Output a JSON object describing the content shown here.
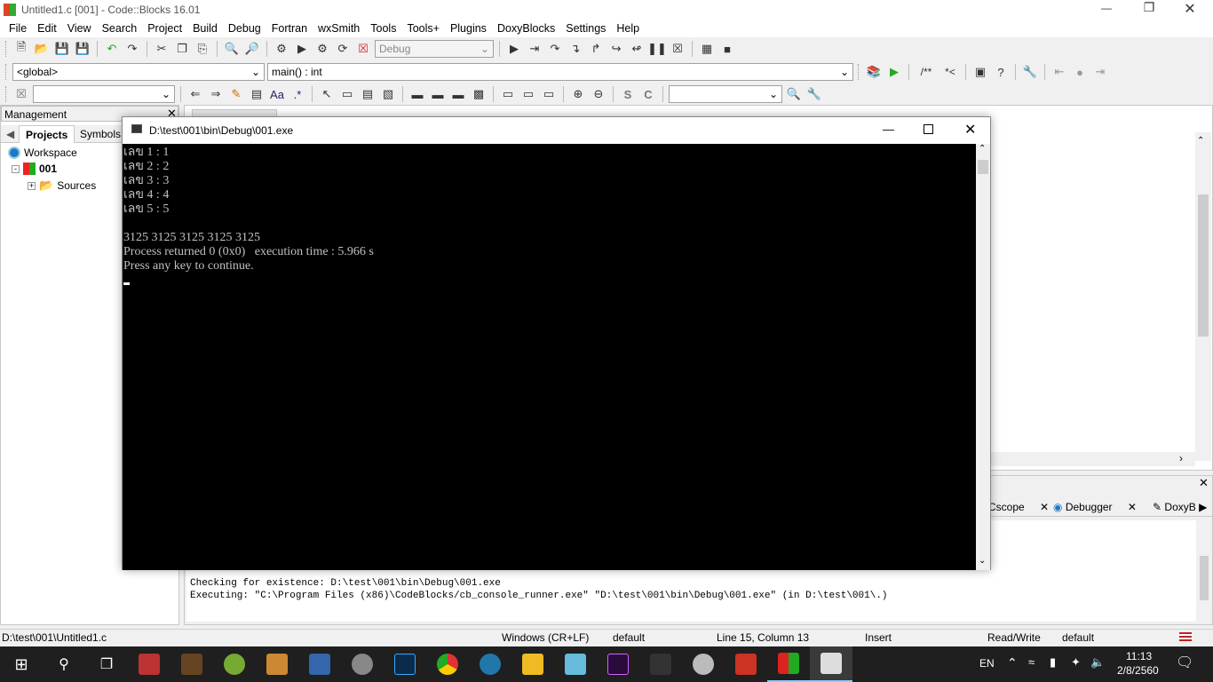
{
  "window": {
    "title": "Untitled1.c [001] - Code::Blocks 16.01"
  },
  "menu": [
    "File",
    "Edit",
    "View",
    "Search",
    "Project",
    "Build",
    "Debug",
    "Fortran",
    "wxSmith",
    "Tools",
    "Tools+",
    "Plugins",
    "DoxyBlocks",
    "Settings",
    "Help"
  ],
  "toolbar": {
    "build_target": "Debug",
    "scope": "<global>",
    "function": "main() : int",
    "comment_btn": "/**",
    "comment_btn2": "*<"
  },
  "management": {
    "title": "Management",
    "tabs": [
      "Projects",
      "Symbols"
    ],
    "tree": {
      "workspace": "Workspace",
      "project": "001",
      "folder": "Sources"
    }
  },
  "console": {
    "title": "D:\\test\\001\\bin\\Debug\\001.exe",
    "lines": [
      "เลข 1 : 1",
      "เลข 2 : 2",
      "เลข 3 : 3",
      "เลข 4 : 4",
      "เลข 5 : 5",
      "",
      "3125 3125 3125 3125 3125",
      "Process returned 0 (0x0)   execution time : 5.966 s",
      "Press any key to continue."
    ]
  },
  "logs": {
    "tabs": [
      "Cscope",
      "Debugger",
      "DoxyB"
    ],
    "lines": [
      "Checking for existence: D:\\test\\001\\bin\\Debug\\001.exe",
      "Executing: \"C:\\Program Files (x86)\\CodeBlocks/cb_console_runner.exe\" \"D:\\test\\001\\bin\\Debug\\001.exe\"  (in D:\\test\\001\\.)"
    ]
  },
  "status": {
    "file": "D:\\test\\001\\Untitled1.c",
    "eol": "Windows (CR+LF)",
    "encoding": "default",
    "position": "Line 15, Column 13",
    "mode": "Insert",
    "access": "Read/Write",
    "profile": "default"
  },
  "taskbar": {
    "lang": "EN",
    "time": "11:13",
    "date": "2/8/2560"
  },
  "colors": {
    "console_bg": "#000000",
    "console_fg": "#c0c0c0",
    "taskbar": "#1f1f1f"
  }
}
